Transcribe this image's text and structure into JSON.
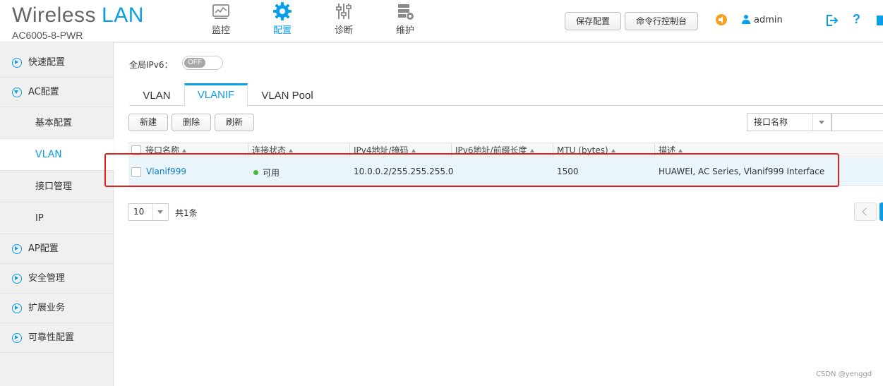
{
  "brand": {
    "title_main": "Wireless",
    "title_accent": "LAN",
    "model": "AC6005-8-PWR"
  },
  "nav": [
    {
      "label": "监控",
      "icon": "monitor-icon",
      "active": false
    },
    {
      "label": "配置",
      "icon": "gear-icon",
      "active": true
    },
    {
      "label": "诊断",
      "icon": "sliders-icon",
      "active": false
    },
    {
      "label": "维护",
      "icon": "maintenance-icon",
      "active": false
    }
  ],
  "header_actions": {
    "save_config": "保存配置",
    "cli_console": "命令行控制台",
    "username": "admin",
    "help": "?"
  },
  "sidebar": {
    "quick_config": "快速配置",
    "ac_config": "AC配置",
    "sub_items": [
      "基本配置",
      "VLAN",
      "接口管理",
      "IP"
    ],
    "ap_config": "AP配置",
    "security": "安全管理",
    "extended": "扩展业务",
    "reliability": "可靠性配置"
  },
  "main": {
    "ipv6_label": "全局IPv6：",
    "ipv6_toggle": "OFF",
    "tabs": [
      "VLAN",
      "VLANIF",
      "VLAN Pool"
    ],
    "active_tab": "VLANIF",
    "toolbar": {
      "new": "新建",
      "delete": "删除",
      "refresh": "刷新"
    },
    "filter": {
      "field": "接口名称",
      "value": ""
    },
    "table": {
      "columns": [
        "接口名称",
        "连接状态",
        "IPv4地址/掩码",
        "IPv6地址/前缀长度",
        "MTU (bytes)",
        "描述"
      ],
      "rows": [
        {
          "name": "Vlanif999",
          "status": "可用",
          "ipv4": "10.0.0.2/255.255.255.0",
          "ipv6": "",
          "mtu": "1500",
          "desc": "HUAWEI, AC Series, Vlanif999 Interface"
        }
      ]
    },
    "pager": {
      "page_size": "10",
      "total": "共1条"
    }
  },
  "watermark": "CSDN @yenggd",
  "colors": {
    "accent": "#0b9ee8",
    "highlight_box": "#e0201c",
    "status_ok": "#4cb83a",
    "notice": "#f4a020"
  }
}
